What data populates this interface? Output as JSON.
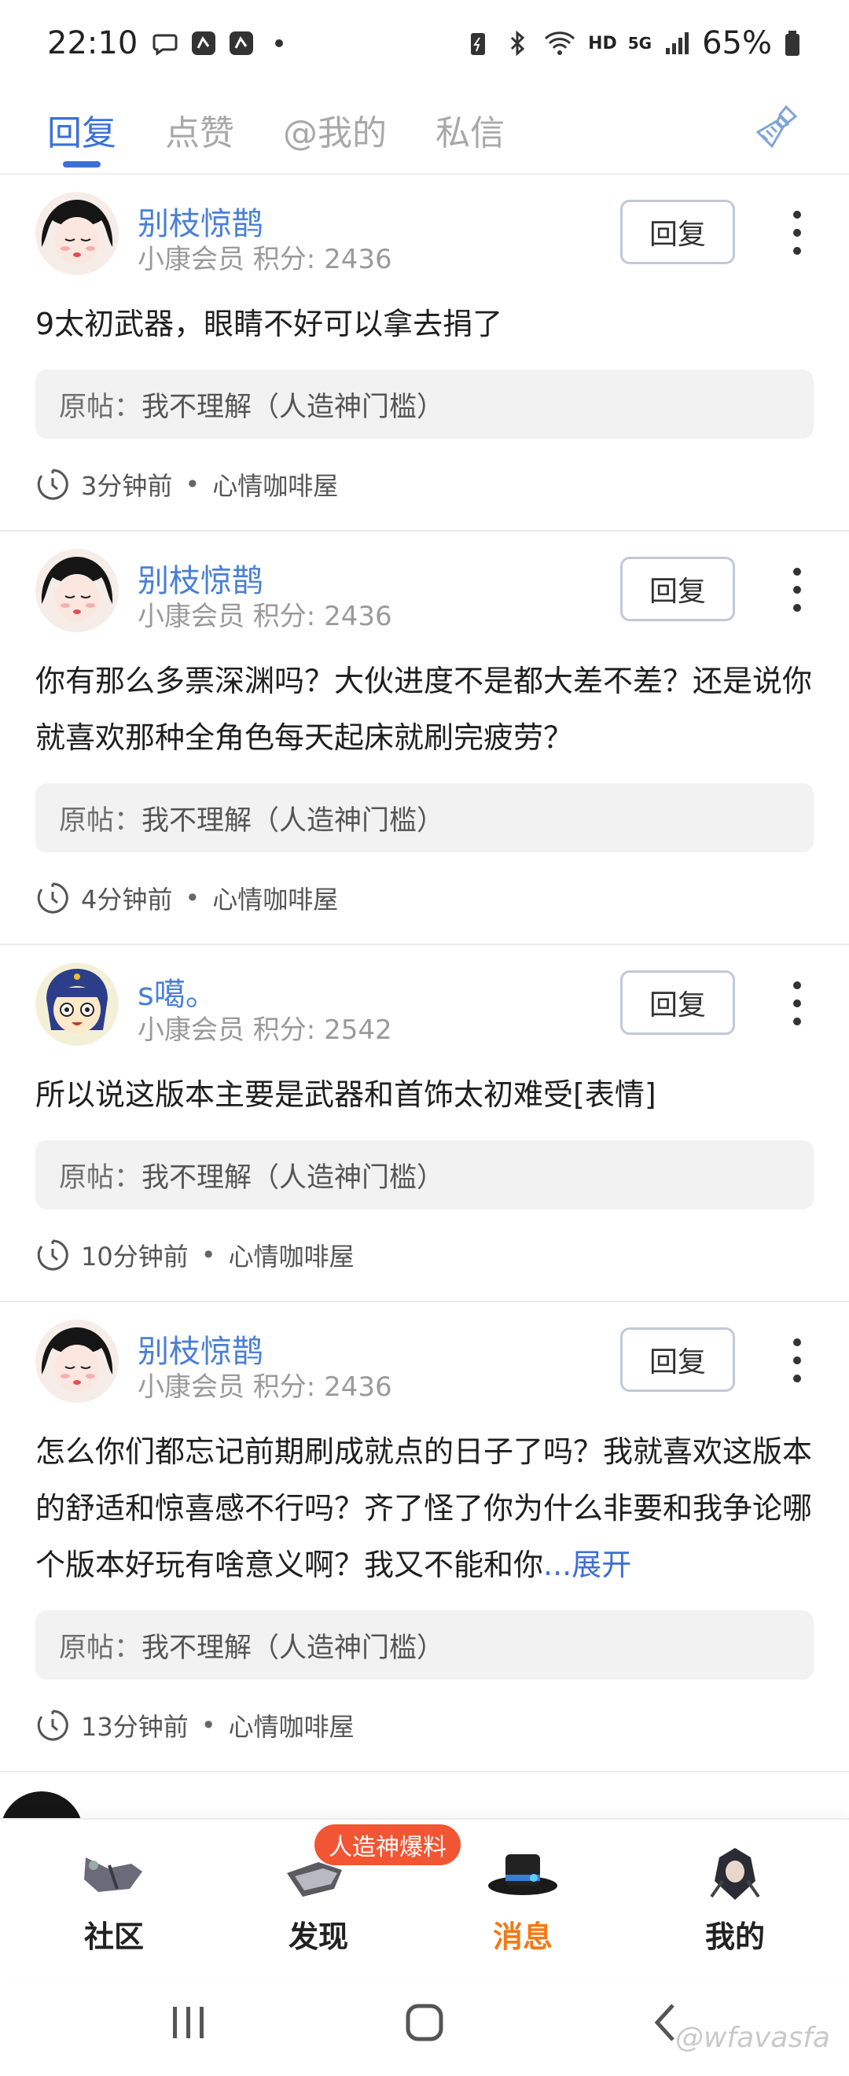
{
  "status_bar": {
    "time": "22:10",
    "network": "5G",
    "hd": "HD",
    "battery": "65%"
  },
  "tabs": [
    {
      "label": "回复",
      "active": true
    },
    {
      "label": "点赞"
    },
    {
      "label": "@我的"
    },
    {
      "label": "私信"
    }
  ],
  "items": [
    {
      "user": "别枝惊鹊",
      "meta": "小康会员 积分: 2436",
      "reply_label": "回复",
      "content": "9太初武器，眼睛不好可以拿去捐了",
      "origin_label": "原帖：",
      "origin_title": "我不理解（人造神门槛）",
      "time": "3分钟前",
      "board": "心情咖啡屋"
    },
    {
      "user": "别枝惊鹊",
      "meta": "小康会员 积分: 2436",
      "reply_label": "回复",
      "content": "你有那么多票深渊吗？大伙进度不是都大差不差？还是说你就喜欢那种全角色每天起床就刷完疲劳？",
      "origin_label": "原帖：",
      "origin_title": "我不理解（人造神门槛）",
      "time": "4分钟前",
      "board": "心情咖啡屋"
    },
    {
      "user": "s噶。",
      "meta": "小康会员 积分: 2542",
      "reply_label": "回复",
      "content": "所以说这版本主要是武器和首饰太初难受[表情]",
      "origin_label": "原帖：",
      "origin_title": "我不理解（人造神门槛）",
      "time": "10分钟前",
      "board": "心情咖啡屋"
    },
    {
      "user": "别枝惊鹊",
      "meta": "小康会员 积分: 2436",
      "reply_label": "回复",
      "content": "怎么你们都忘记前期刷成就点的日子了吗？我就喜欢这版本的舒适和惊喜感不行吗？齐了怪了你为什么非要和我争论哪个版本好玩有啥意义啊？我又不能和你",
      "expand": "...展开",
      "origin_label": "原帖：",
      "origin_title": "我不理解（人造神门槛）",
      "time": "13分钟前",
      "board": "心情咖啡屋"
    }
  ],
  "bottom_nav": {
    "badge": "人造神爆料",
    "items": [
      {
        "label": "社区",
        "icon": "community-icon"
      },
      {
        "label": "发现",
        "icon": "discover-icon"
      },
      {
        "label": "消息",
        "icon": "message-icon",
        "active": true
      },
      {
        "label": "我的",
        "icon": "profile-icon"
      }
    ]
  },
  "watermark": "@wfavasfa",
  "colors": {
    "accent": "#3c6fd8",
    "active_nav": "#f07a16",
    "badge": "#f25533"
  }
}
